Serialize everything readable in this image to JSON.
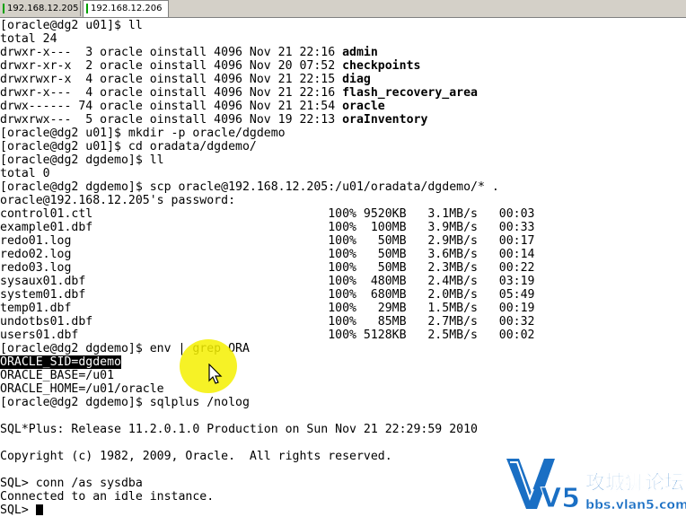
{
  "tabs": [
    {
      "label": "192.168.12.205",
      "active": false
    },
    {
      "label": "192.168.12.206",
      "active": true
    }
  ],
  "terminal": {
    "lines": [
      "[oracle@dg2 u01]$ ll",
      "total 24",
      "drwxr-x---  3 oracle oinstall 4096 Nov 21 22:16 ",
      "drwxr-xr-x  2 oracle oinstall 4096 Nov 20 07:52 ",
      "drwxrwxr-x  4 oracle oinstall 4096 Nov 21 22:15 ",
      "drwxr-x---  4 oracle oinstall 4096 Nov 21 22:16 ",
      "drwx------ 74 oracle oinstall 4096 Nov 21 21:54 ",
      "drwxrwx---  5 oracle oinstall 4096 Nov 19 22:13 ",
      "[oracle@dg2 u01]$ mkdir -p oracle/dgdemo",
      "[oracle@dg2 u01]$ cd oradata/dgdemo/",
      "[oracle@dg2 dgdemo]$ ll",
      "total 0",
      "[oracle@dg2 dgdemo]$ scp oracle@192.168.12.205:/u01/oradata/dgdemo/* .",
      "oracle@192.168.12.205's password:",
      "control01.ctl                                 100% 9520KB   3.1MB/s   00:03",
      "example01.dbf                                 100%  100MB   3.9MB/s   00:33",
      "redo01.log                                    100%   50MB   2.9MB/s   00:17",
      "redo02.log                                    100%   50MB   3.6MB/s   00:14",
      "redo03.log                                    100%   50MB   2.3MB/s   00:22",
      "sysaux01.dbf                                  100%  480MB   2.4MB/s   03:19",
      "system01.dbf                                  100%  680MB   2.0MB/s   05:49",
      "temp01.dbf                                    100%   29MB   1.5MB/s   00:19",
      "undotbs01.dbf                                 100%   85MB   2.7MB/s   00:32",
      "users01.dbf                                   100% 5128KB   2.5MB/s   00:02",
      "[oracle@dg2 dgdemo]$ env | grep ORA",
      "",
      "ORACLE_BASE=/u01",
      "ORACLE_HOME=/u01/oracle",
      "[oracle@dg2 dgdemo]$ sqlplus /nolog",
      "",
      "SQL*Plus: Release 11.2.0.1.0 Production on Sun Nov 21 22:29:59 2010",
      "",
      "Copyright (c) 1982, 2009, Oracle.  All rights reserved.",
      "",
      "SQL> conn /as sysdba",
      "Connected to an idle instance.",
      "SQL> "
    ],
    "dir_names": [
      "admin",
      "checkpoints",
      "diag",
      "flash_recovery_area",
      "oracle",
      "oraInventory"
    ],
    "highlighted": "ORACLE_SID=dgdemo"
  },
  "watermark": {
    "brand": "V5",
    "site_cn": "攻城狮论坛",
    "site_url": "bbs.vlan5.com"
  },
  "colors": {
    "tab_indicator": "#00a000",
    "highlight_pointer": "#f5f000",
    "logo_blue": "#1a6fc4"
  }
}
